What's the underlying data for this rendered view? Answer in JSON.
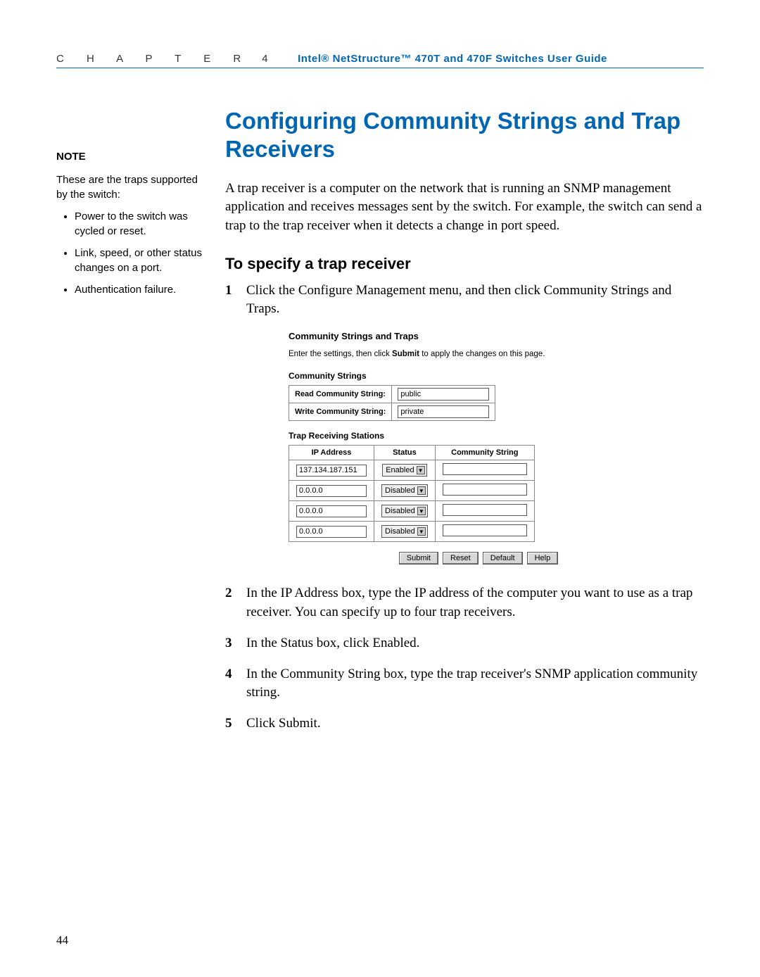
{
  "header": {
    "chapter_word": "C H A P T E R",
    "chapter_num": "4",
    "title": "Intel® NetStructure™ 470T and 470F Switches User Guide"
  },
  "sidebar": {
    "heading": "NOTE",
    "intro": "These are the traps supported by the switch:",
    "items": [
      "Power to the switch was cycled or reset.",
      "Link, speed, or other status changes on a port.",
      "Authentication failure."
    ]
  },
  "main": {
    "h1": "Configuring Community Strings and Trap Receivers",
    "intro": "A trap receiver is a computer on the network that is running an SNMP management application and receives messages sent by the switch. For example, the switch can send a trap to the trap receiver when it detects a change in port speed.",
    "h2": "To specify a trap receiver",
    "steps": [
      "Click the Configure Management menu, and then click Community Strings and Traps.",
      "In the IP Address box, type the IP address of the computer you want to use as a trap receiver. You can specify up to four trap receivers.",
      "In the Status box, click Enabled.",
      "In the Community String box, type the trap receiver's SNMP application community string.",
      "Click Submit."
    ]
  },
  "screenshot": {
    "title": "Community Strings and Traps",
    "instr_pre": "Enter the settings, then click ",
    "instr_bold": "Submit",
    "instr_post": " to apply the changes on this page.",
    "cs_heading": "Community Strings",
    "cs_rows": [
      {
        "label": "Read Community String:",
        "value": "public"
      },
      {
        "label": "Write Community String:",
        "value": "private"
      }
    ],
    "tr_heading": "Trap Receiving Stations",
    "tr_cols": [
      "IP Address",
      "Status",
      "Community String"
    ],
    "tr_rows": [
      {
        "ip": "137.134.187.151",
        "status": "Enabled",
        "cs": ""
      },
      {
        "ip": "0.0.0.0",
        "status": "Disabled",
        "cs": ""
      },
      {
        "ip": "0.0.0.0",
        "status": "Disabled",
        "cs": ""
      },
      {
        "ip": "0.0.0.0",
        "status": "Disabled",
        "cs": ""
      }
    ],
    "buttons": [
      "Submit",
      "Reset",
      "Default",
      "Help"
    ]
  },
  "page_number": "44"
}
